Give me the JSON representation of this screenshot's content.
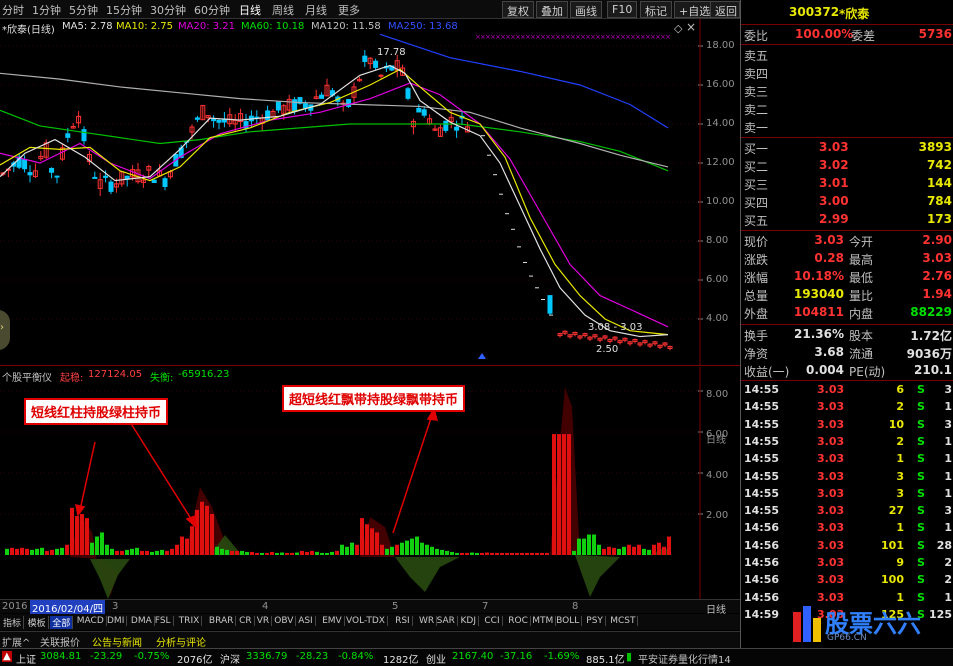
{
  "period_tabs": [
    "分时",
    "1分钟",
    "5分钟",
    "15分钟",
    "30分钟",
    "60分钟",
    "日线",
    "周线",
    "月线",
    "更多"
  ],
  "active_tab": "日线",
  "toolbar": {
    "btn1": "复权",
    "btn2": "叠加",
    "btn3": "画线",
    "btn4": "F10",
    "btn5": "标记",
    "btn6": "+自选",
    "btn7": "返回"
  },
  "ma_legend": {
    "name": "*欣泰(日线)",
    "ma5": "MA5: 2.78",
    "ma10": "MA10: 2.75",
    "ma20": "MA20: 3.21",
    "ma60": "MA60: 10.18",
    "ma120": "MA120: 11.58",
    "ma250": "MA250: 13.68"
  },
  "price_axis": [
    "18.00",
    "16.00",
    "14.00",
    "12.00",
    "10.00",
    "8.00",
    "6.00",
    "4.00"
  ],
  "price_notes": {
    "high": "17.78",
    "range": "3.08 - 3.03",
    "low": "2.50"
  },
  "sub_indicator": {
    "name": "个股平衡仪",
    "label1": "起稳:",
    "value1": "127124.05",
    "label2": "失衡:",
    "value2": "-65916.23"
  },
  "sub_axis": [
    "8.00",
    "6.00",
    "4.00",
    "2.00"
  ],
  "callouts": {
    "left": "短线红柱持股绿柱持币",
    "right": "超短线红飘带持股绿飘带持币"
  },
  "date_bar": {
    "year": "2016",
    "date": "2016/02/04/四",
    "m3": "3",
    "m4": "4",
    "m5": "5",
    "m7": "7",
    "m8": "8",
    "period": "日线"
  },
  "side_label": "日线",
  "indicators": [
    "指标",
    "模板",
    "全部",
    "MACD",
    "DMI",
    "DMA",
    "FSL",
    "TRIX",
    "BRAR",
    "CR",
    "VR",
    "OBV",
    "ASI",
    "EMV",
    "VOL-TDX",
    "RSI",
    "WR",
    "SAR",
    "KDJ",
    "CCI",
    "ROC",
    "MTM",
    "BOLL",
    "PSY",
    "MCST"
  ],
  "info_tabs": [
    "扩展^",
    "关联报价",
    "公告与新闻",
    "分析与评论"
  ],
  "status": {
    "sh_name": "上证",
    "sh_val": "3084.81",
    "sh_chg": "-23.29",
    "sh_pct": "-0.75%",
    "sh_amt": "2076亿",
    "hs_name": "沪深",
    "hs_val": "3336.79",
    "hs_chg": "-28.23",
    "hs_pct": "-0.84%",
    "hs_amt": "1282亿",
    "cy_name": "创业",
    "cy_val": "2167.40",
    "cy_chg": "-37.16",
    "cy_pct": "-1.69%",
    "cy_amt": "885.1亿",
    "broker": "平安证券量化行情14"
  },
  "quote": {
    "code": "300372",
    "name": "*欣泰",
    "weibi_label": "委比",
    "weibi_val": "100.00%",
    "weicha_label": "委差",
    "weicha_val": "5736",
    "sells": [
      "卖五",
      "卖四",
      "卖三",
      "卖二",
      "卖一"
    ],
    "buys": [
      {
        "label": "买一",
        "price": "3.03",
        "vol": "3893"
      },
      {
        "label": "买二",
        "price": "3.02",
        "vol": "742"
      },
      {
        "label": "买三",
        "price": "3.01",
        "vol": "144"
      },
      {
        "label": "买四",
        "price": "3.00",
        "vol": "784"
      },
      {
        "label": "买五",
        "price": "2.99",
        "vol": "173"
      }
    ],
    "stats": [
      {
        "l1": "现价",
        "v1": "3.03",
        "l2": "今开",
        "v2": "2.90"
      },
      {
        "l1": "涨跌",
        "v1": "0.28",
        "l2": "最高",
        "v2": "3.03"
      },
      {
        "l1": "涨幅",
        "v1": "10.18%",
        "l2": "最低",
        "v2": "2.76"
      },
      {
        "l1": "总量",
        "v1": "193040",
        "l2": "量比",
        "v2": "1.94"
      },
      {
        "l1": "外盘",
        "v1": "104811",
        "l2": "内盘",
        "v2": "88229"
      }
    ],
    "stats2": [
      {
        "l1": "换手",
        "v1": "21.36%",
        "l2": "股本",
        "v2": "1.72亿"
      },
      {
        "l1": "净资",
        "v1": "3.68",
        "l2": "流通",
        "v2": "9036万"
      },
      {
        "l1": "收益(一)",
        "v1": "0.004",
        "l2": "PE(动)",
        "v2": "210.1"
      }
    ],
    "ticks": [
      {
        "t": "14:55",
        "p": "3.03",
        "v": "6",
        "d": "S",
        "x": "3"
      },
      {
        "t": "14:55",
        "p": "3.03",
        "v": "2",
        "d": "S",
        "x": "1"
      },
      {
        "t": "14:55",
        "p": "3.03",
        "v": "10",
        "d": "S",
        "x": "3"
      },
      {
        "t": "14:55",
        "p": "3.03",
        "v": "2",
        "d": "S",
        "x": "1"
      },
      {
        "t": "14:55",
        "p": "3.03",
        "v": "1",
        "d": "S",
        "x": "1"
      },
      {
        "t": "14:55",
        "p": "3.03",
        "v": "3",
        "d": "S",
        "x": "1"
      },
      {
        "t": "14:55",
        "p": "3.03",
        "v": "3",
        "d": "S",
        "x": "1"
      },
      {
        "t": "14:55",
        "p": "3.03",
        "v": "27",
        "d": "S",
        "x": "3"
      },
      {
        "t": "14:56",
        "p": "3.03",
        "v": "1",
        "d": "S",
        "x": "1"
      },
      {
        "t": "14:56",
        "p": "3.03",
        "v": "101",
        "d": "S",
        "x": "28"
      },
      {
        "t": "14:56",
        "p": "3.03",
        "v": "9",
        "d": "S",
        "x": "2"
      },
      {
        "t": "14:56",
        "p": "3.03",
        "v": "100",
        "d": "S",
        "x": "2"
      },
      {
        "t": "14:56",
        "p": "3.03",
        "v": "1",
        "d": "S",
        "x": "1"
      },
      {
        "t": "14:59",
        "p": "3.03",
        "v": "125",
        "d": "S",
        "x": "125"
      }
    ],
    "watermark": "股票六六",
    "watermark_url": "GP66.CN"
  },
  "colors": {
    "up": "#ff3232",
    "down": "#00e000",
    "ma5": "#e0e0e0",
    "ma10": "#e8e800",
    "ma20": "#e000e0",
    "ma60": "#00c000",
    "ma120": "#c0c0c0",
    "ma250": "#2040ff"
  }
}
